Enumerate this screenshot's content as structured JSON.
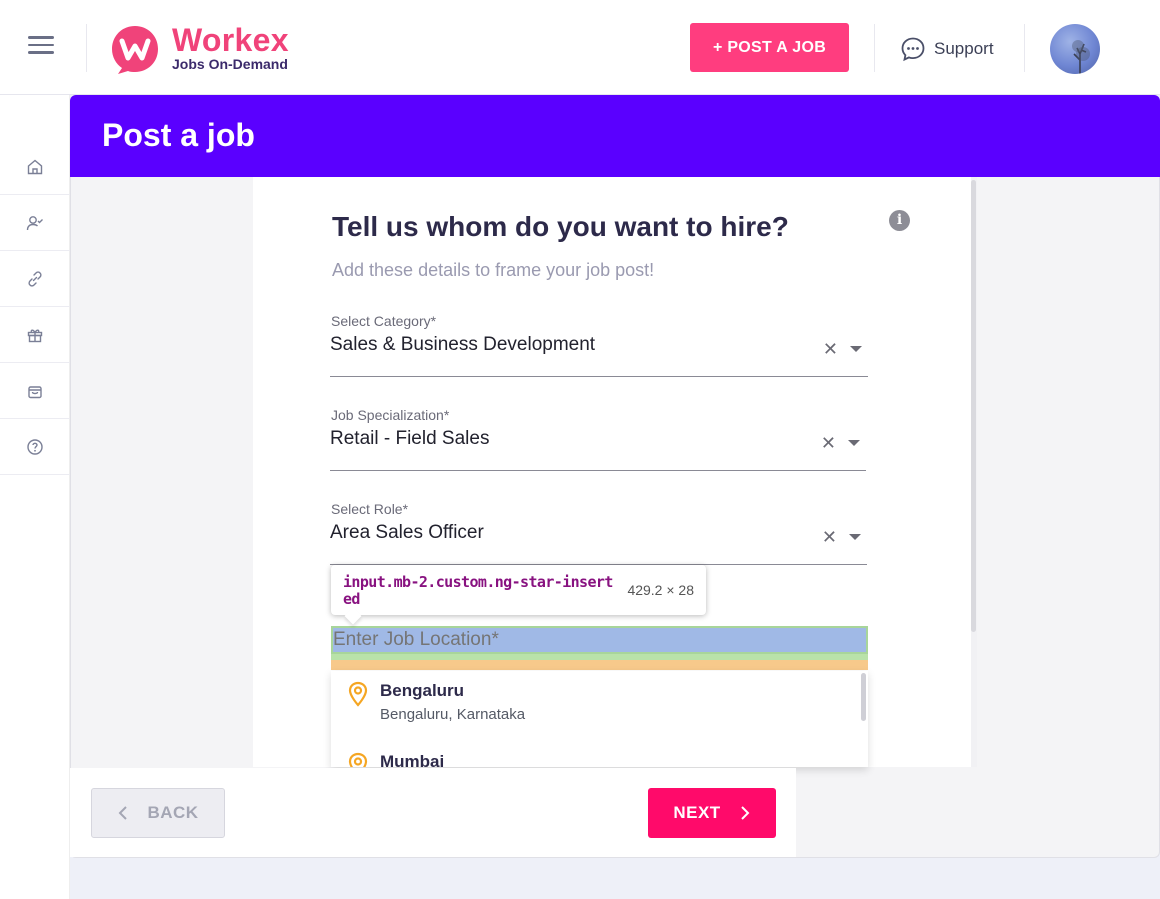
{
  "header": {
    "brand_name": "Workex",
    "brand_tagline": "Jobs On-Demand",
    "post_job_label": "+ POST A JOB",
    "support_label": "Support"
  },
  "sidebar": {
    "items": [
      {
        "icon": "home-icon"
      },
      {
        "icon": "candidates-icon"
      },
      {
        "icon": "link-icon"
      },
      {
        "icon": "gift-icon"
      },
      {
        "icon": "bag-icon"
      },
      {
        "icon": "help-icon"
      }
    ]
  },
  "page": {
    "title": "Post a job",
    "question": "Tell us whom do you want to hire?",
    "subtitle": "Add these details to frame your job post!"
  },
  "form": {
    "category": {
      "label": "Select Category*",
      "value": "Sales & Business Development"
    },
    "specialization": {
      "label": "Job Specialization*",
      "value": "Retail - Field Sales"
    },
    "role": {
      "label": "Select Role*",
      "value": "Area Sales Officer"
    },
    "location": {
      "placeholder": "Enter Job Location*",
      "value": ""
    }
  },
  "devtools_tooltip": {
    "selector": "input.mb-2.custom.ng-star-inserted",
    "size": "429.2 × 28"
  },
  "location_suggestions": [
    {
      "city": "Bengaluru",
      "region": "Bengaluru, Karnataka"
    },
    {
      "city": "Mumbai",
      "region": ""
    }
  ],
  "footer": {
    "back_label": "BACK",
    "next_label": "NEXT"
  },
  "colors": {
    "brand_pink": "#f0437a",
    "banner_purple": "#5a00ff",
    "next_button": "#ff0a6a",
    "pin_orange": "#f5a623"
  }
}
